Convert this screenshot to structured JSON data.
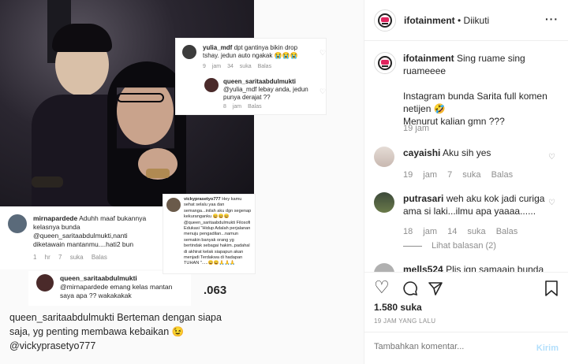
{
  "media": {
    "comments": [
      {
        "user": "yulia_mdf",
        "text": "dpt gantinya bikin drop tshay. jedun auto ngakak 😭😭😭",
        "time": "9 jam",
        "likes": "34 suka",
        "reply": "Balas"
      },
      {
        "user": "queen_saritaabdulmukti",
        "text": "@yulia_mdf lebay anda, jedun punya derajat ??",
        "time": "8 jam",
        "reply": "Balas"
      },
      {
        "user": "mirnapardede",
        "text": "Aduhh maaf bukannya kelasnya bunda @queen_saritaabdulmukti,nanti diketawain mantanmu....hati2 bun",
        "time": "1 hr",
        "likes": "7 suka",
        "reply": "Balas"
      },
      {
        "user": "queen_saritaabdulmukti",
        "text": "@mirnapardede emang kelas mantan saya apa ?? wakakakak",
        "time": ".063"
      },
      {
        "user": "vickyprasetyo777",
        "text": "Hey kamu sehat selalu yaa dan semanga...inilah aku dgn segenap kekuranganku 😄😄😄 @queen_saritaabdulmukti Filosofi Edukasi \"Hidup Adalah perjalanan menuju pengadilan...namun semakin banyak orang yg bertindak sebagai hakim..padahal di akhirat kelak siapapun akan menjadi Terdakwa di hadapan TUHAN \".....😄😄🙏🙏🙏"
      }
    ],
    "caption": "queen_saritaabdulmukti Berteman dengan siapa saja, yg penting membawa kebaikan 😉 @vickyprasetyo777"
  },
  "header": {
    "username": "ifotainment",
    "separator": " • ",
    "follow_label": "Diikuti"
  },
  "post": {
    "author": "ifotainment",
    "caption_line1": "Sing ruame sing ruameeee",
    "caption_line2": "Instagram bunda Sarita full komen netijen 🤣",
    "caption_line3": "Menurut kalian gmn ???",
    "caption_time": "19 jam"
  },
  "comments": [
    {
      "user": "cayaishi",
      "text": "Aku sih yes",
      "time": "19 jam",
      "likes": "7 suka",
      "reply": "Balas"
    },
    {
      "user": "putrasari",
      "text": "weh aku kok jadi curiga ama si laki...ilmu apa yaaaa......",
      "time": "18 jam",
      "likes": "14 suka",
      "reply": "Balas",
      "view_replies": "Lihat balasan (2)"
    },
    {
      "user": "mells524",
      "text": "Plis jgn samaain bunda"
    }
  ],
  "likes": "1.580 suka",
  "date": "19 JAM YANG LALU",
  "add_comment": {
    "placeholder": "Tambahkan komentar...",
    "post_label": "Kirim"
  },
  "icons": [
    "heart-icon",
    "comment-icon",
    "share-icon",
    "bookmark-icon",
    "more-icon"
  ]
}
